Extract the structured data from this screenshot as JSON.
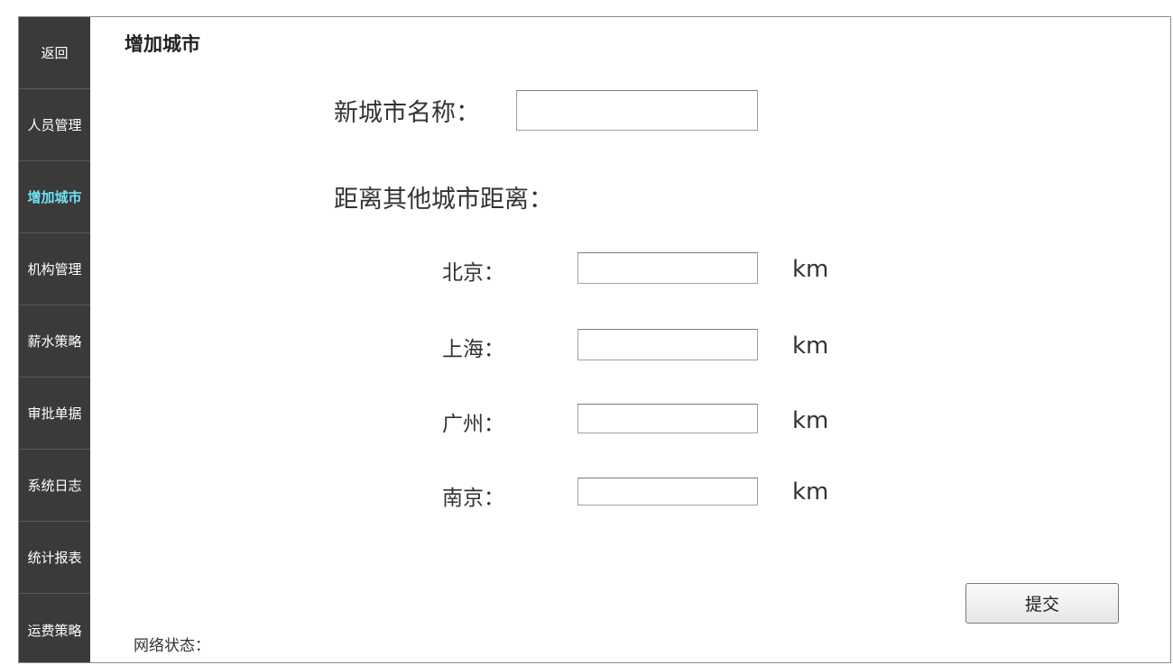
{
  "sidebar": {
    "items": [
      {
        "label": "返回"
      },
      {
        "label": "人员管理"
      },
      {
        "label": "增加城市",
        "active": true
      },
      {
        "label": "机构管理"
      },
      {
        "label": "薪水策略"
      },
      {
        "label": "审批单据"
      },
      {
        "label": "系统日志"
      },
      {
        "label": "统计报表"
      },
      {
        "label": "运费策略"
      }
    ]
  },
  "header": {
    "title": "增加城市"
  },
  "form": {
    "new_city_label": "新城市名称：",
    "new_city_value": "",
    "distance_heading": "距离其他城市距离：",
    "cities": [
      {
        "label": "北京：",
        "value": "",
        "unit": "km"
      },
      {
        "label": "上海：",
        "value": "",
        "unit": "km"
      },
      {
        "label": "广州：",
        "value": "",
        "unit": "km"
      },
      {
        "label": "南京：",
        "value": "",
        "unit": "km"
      }
    ],
    "submit_label": "提交"
  },
  "footer": {
    "network_status_label": "网络状态："
  },
  "colors": {
    "sidebar_bg": "#3a3a3a",
    "sidebar_text": "#ffffff",
    "sidebar_active_text": "#6fe0f0"
  }
}
